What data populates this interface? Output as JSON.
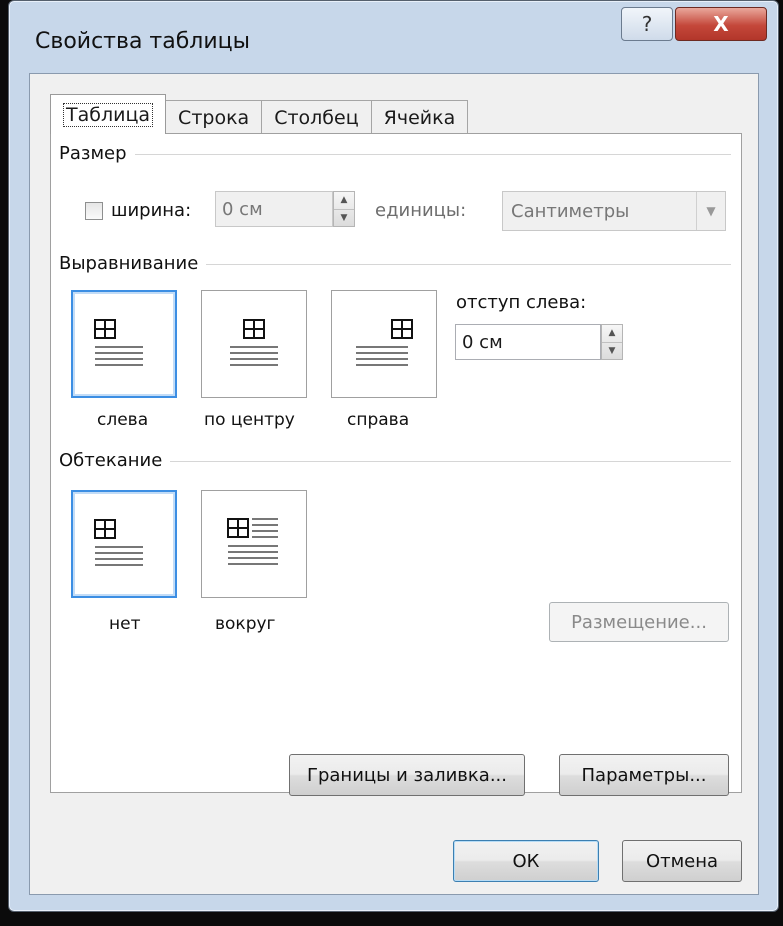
{
  "window": {
    "title": "Свойства таблицы",
    "help_label": "?",
    "close_label": "X"
  },
  "tabs": [
    {
      "label": "Таблица",
      "active": true
    },
    {
      "label": "Строка",
      "active": false
    },
    {
      "label": "Столбец",
      "active": false
    },
    {
      "label": "Ячейка",
      "active": false
    }
  ],
  "size": {
    "heading": "Размер",
    "width_checkbox_checked": false,
    "width_label": "ширина:",
    "width_value": "0 см",
    "units_label": "единицы:",
    "units_value": "Сантиметры"
  },
  "alignment": {
    "heading": "Выравнивание",
    "options": [
      {
        "label": "слева",
        "selected": true,
        "icon": "align-left-icon"
      },
      {
        "label": "по центру",
        "selected": false,
        "icon": "align-center-icon"
      },
      {
        "label": "справа",
        "selected": false,
        "icon": "align-right-icon"
      }
    ],
    "indent_label": "отступ слева:",
    "indent_value": "0 см"
  },
  "wrapping": {
    "heading": "Обтекание",
    "options": [
      {
        "label": "нет",
        "selected": true,
        "icon": "wrap-none-icon"
      },
      {
        "label": "вокруг",
        "selected": false,
        "icon": "wrap-around-icon"
      }
    ],
    "positioning_button": "Размещение..."
  },
  "buttons": {
    "borders": "Границы и заливка...",
    "options": "Параметры...",
    "ok": "ОК",
    "cancel": "Отмена"
  },
  "colors": {
    "selection": "#3c8ee3",
    "close": "#c4473a"
  }
}
